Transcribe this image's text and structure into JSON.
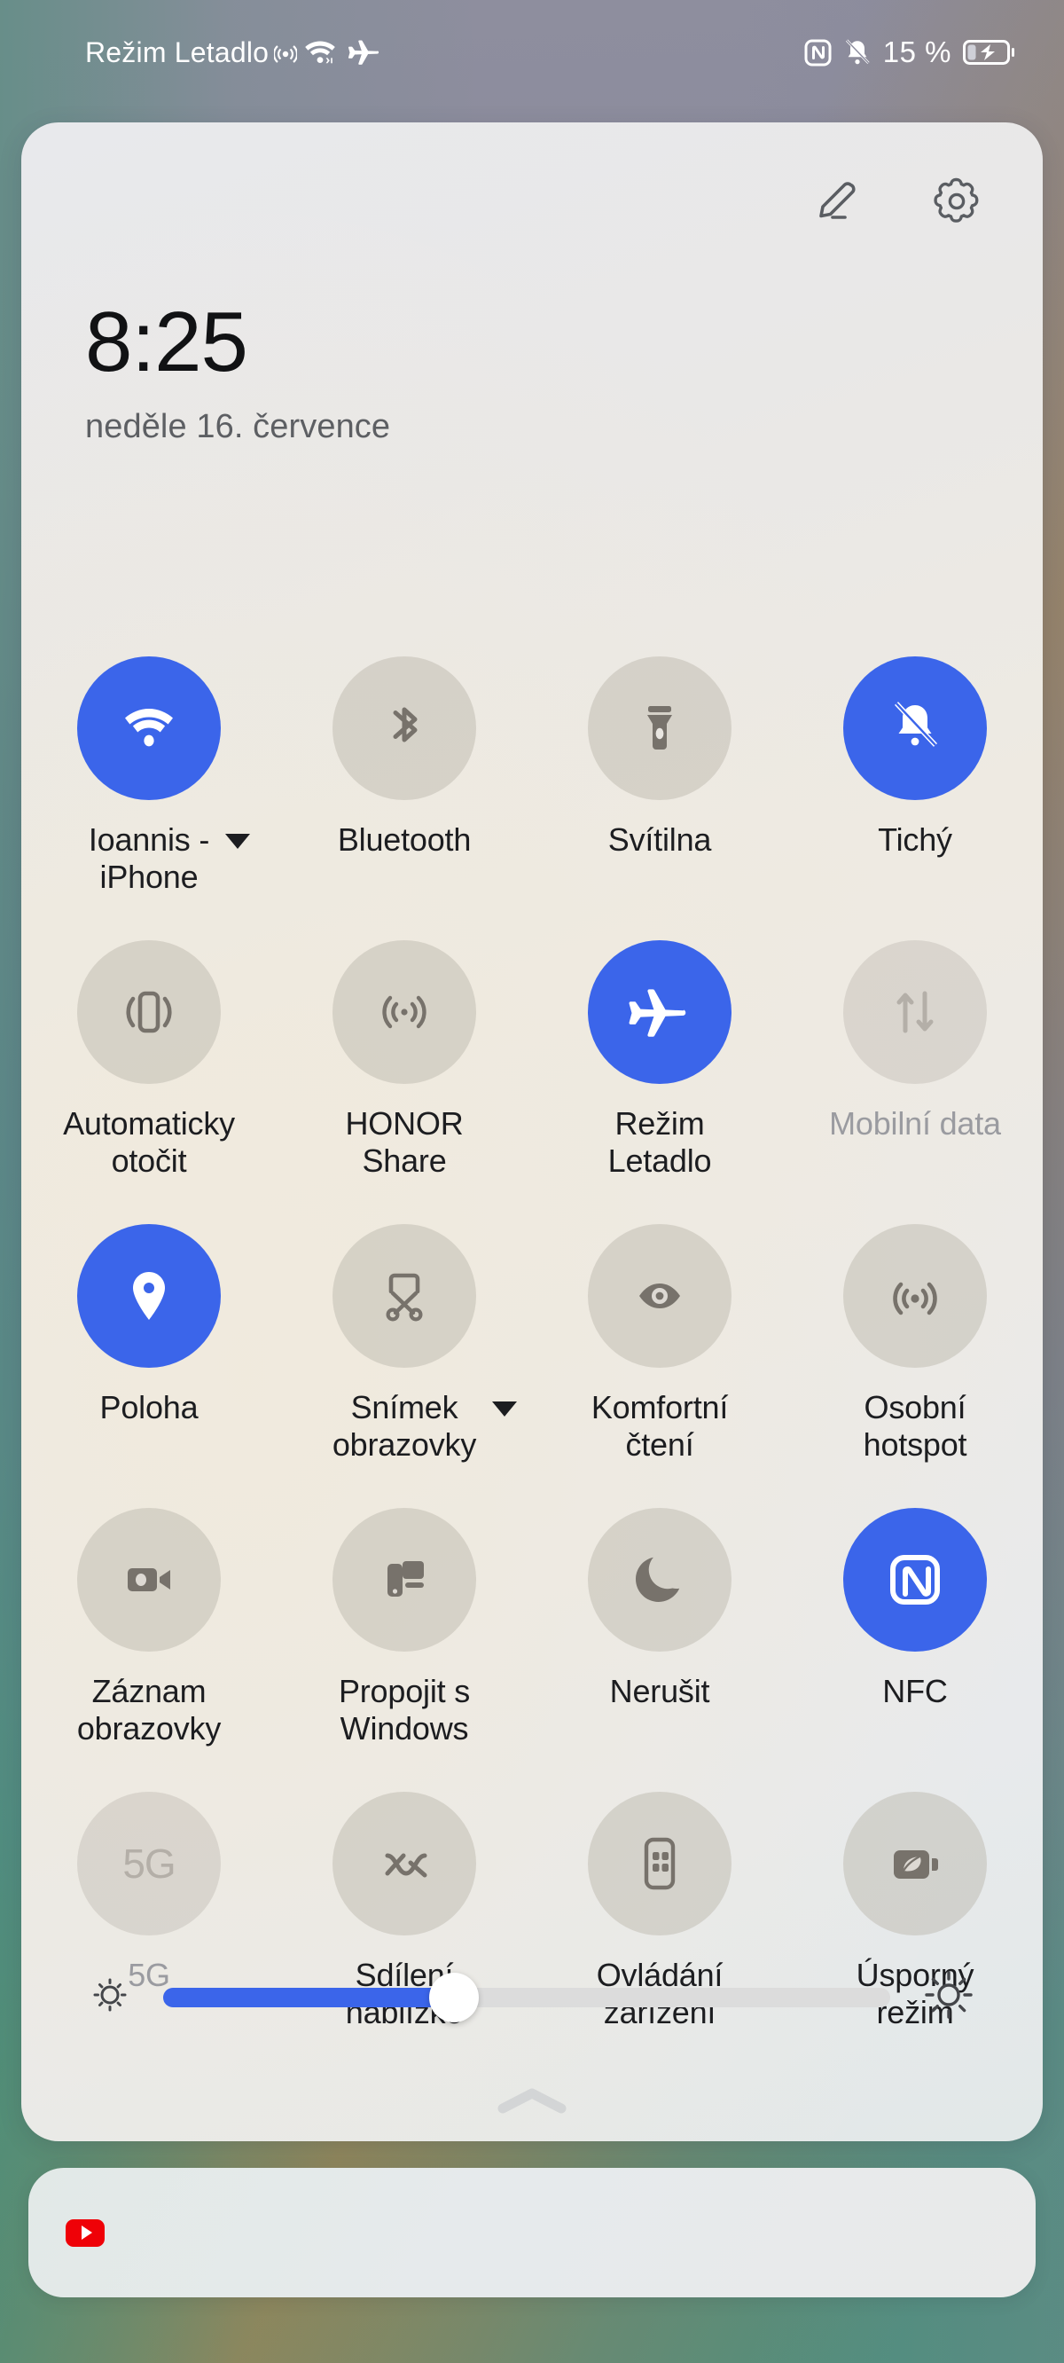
{
  "status_bar": {
    "left_text": "Režim Letadlo",
    "left_icons": [
      "hotspot-icon",
      "wifi-icon",
      "airplane-icon"
    ],
    "battery_percent": "15 %",
    "right_icons": [
      "nfc-icon",
      "bell-muted-icon",
      "battery-charging-icon"
    ]
  },
  "panel": {
    "header": {
      "edit_icon": "pencil-edit-icon",
      "settings_icon": "gear-icon"
    },
    "clock": "8:25",
    "date": "neděle 16. července"
  },
  "tiles": [
    {
      "label": "Ioannis -\niPhone",
      "icon": "wifi-icon",
      "state": "on",
      "caret": true
    },
    {
      "label": "Bluetooth",
      "icon": "bluetooth-icon",
      "state": "off",
      "caret": false
    },
    {
      "label": "Svítilna",
      "icon": "flashlight-icon",
      "state": "off",
      "caret": false
    },
    {
      "label": "Tichý",
      "icon": "bell-muted-icon",
      "state": "on",
      "caret": false
    },
    {
      "label": "Automaticky\notočit",
      "icon": "auto-rotate-icon",
      "state": "off",
      "caret": false
    },
    {
      "label": "HONOR\nShare",
      "icon": "honor-share-icon",
      "state": "off",
      "caret": false
    },
    {
      "label": "Režim\nLetadlo",
      "icon": "airplane-icon",
      "state": "on",
      "caret": false
    },
    {
      "label": "Mobilní data",
      "icon": "mobile-data-icon",
      "state": "disabled",
      "caret": false
    },
    {
      "label": "Poloha",
      "icon": "location-pin-icon",
      "state": "on",
      "caret": false
    },
    {
      "label": "Snímek\nobrazovky",
      "icon": "screenshot-icon",
      "state": "off",
      "caret": true
    },
    {
      "label": "Komfortní\nčtení",
      "icon": "eye-comfort-icon",
      "state": "off",
      "caret": false
    },
    {
      "label": "Osobní\nhotspot",
      "icon": "hotspot-icon",
      "state": "off",
      "caret": false
    },
    {
      "label": "Záznam\nobrazovky",
      "icon": "screen-record-icon",
      "state": "off",
      "caret": false
    },
    {
      "label": "Propojit s\nWindows",
      "icon": "link-windows-icon",
      "state": "off",
      "caret": false
    },
    {
      "label": "Nerušit",
      "icon": "moon-dnd-icon",
      "state": "off",
      "caret": false
    },
    {
      "label": "NFC",
      "icon": "nfc-icon",
      "state": "on",
      "caret": false
    },
    {
      "label": "5G",
      "icon": "five-g-icon",
      "state": "disabled",
      "caret": false
    },
    {
      "label": "Sdílení\nnablízko",
      "icon": "nearby-share-icon",
      "state": "off",
      "caret": false
    },
    {
      "label": "Ovládání\nzařízení",
      "icon": "device-control-icon",
      "state": "off",
      "caret": false
    },
    {
      "label": "Úsporný\nrežim",
      "icon": "battery-saver-icon",
      "state": "off",
      "caret": false
    }
  ],
  "brightness": {
    "low_icon": "brightness-low-icon",
    "high_icon": "brightness-high-icon",
    "value_percent": 40
  },
  "collapse_icon": "chevron-up-icon",
  "notification": {
    "app_icon": "youtube-icon"
  },
  "colors": {
    "accent": "#3b65ea",
    "tile_off": "#bab4ab",
    "label": "#1c1d20",
    "label_disabled": "#9a9ba0",
    "youtube_red": "#ef0107"
  }
}
